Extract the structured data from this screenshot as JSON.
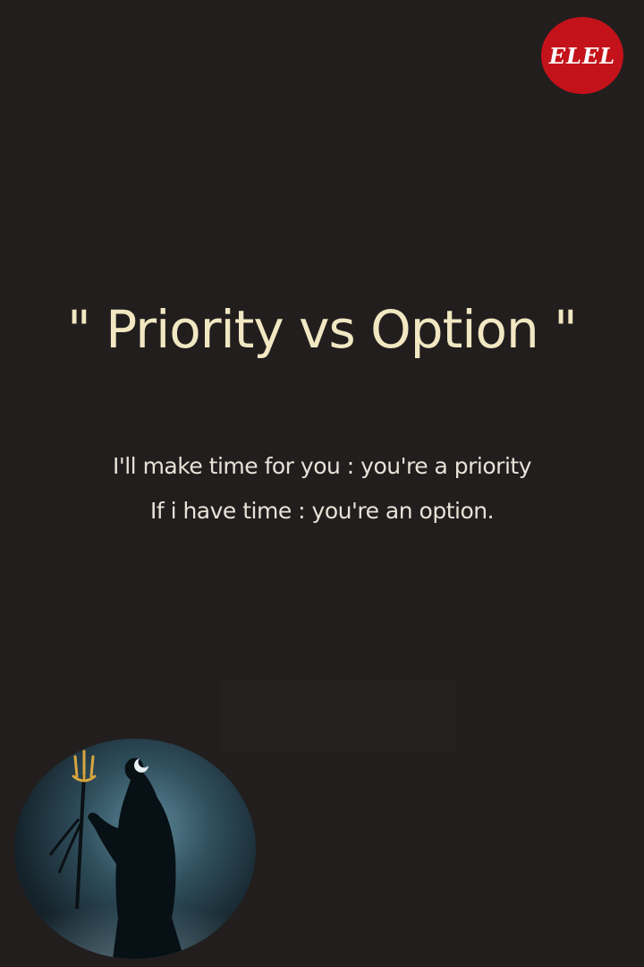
{
  "logo": {
    "text": "ELEL",
    "color": "#c4121a"
  },
  "title": "\" Priority vs Option \"",
  "quote": {
    "line1": "I'll make time for you : you're a priority",
    "line2": "If i have time : you're an option."
  },
  "avatar": {
    "icon": "trident-silhouette-icon"
  },
  "colors": {
    "background": "#221e1e",
    "title": "#f1e7c2",
    "body_text": "#e8e2d8"
  }
}
